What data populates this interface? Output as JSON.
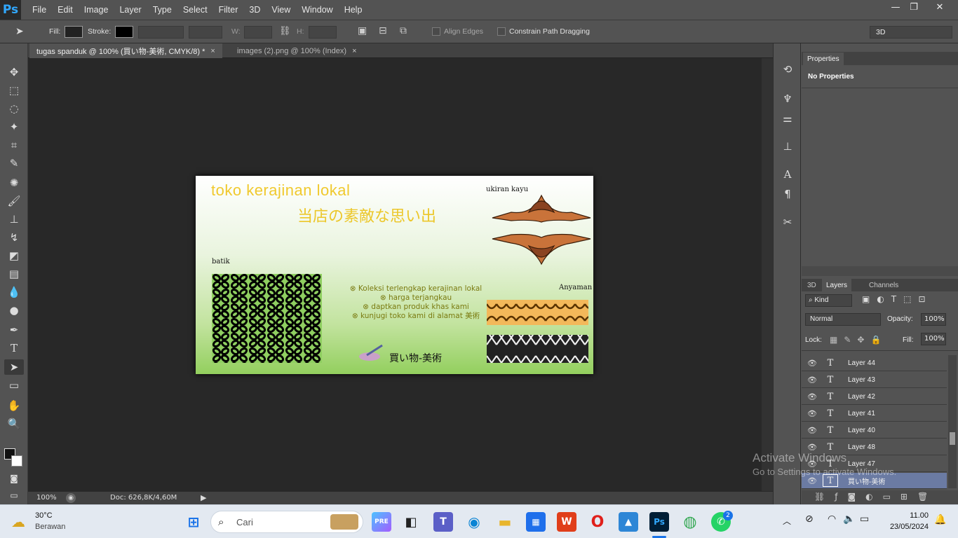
{
  "app": {
    "logo": "Ps"
  },
  "menu": [
    "File",
    "Edit",
    "Image",
    "Layer",
    "Type",
    "Select",
    "Filter",
    "3D",
    "View",
    "Window",
    "Help"
  ],
  "window_controls": {
    "minimize": "—",
    "restore": "❐",
    "close": "✕"
  },
  "options": {
    "fill_label": "Fill:",
    "stroke_label": "Stroke:",
    "w_label": "W:",
    "h_label": "H:",
    "align_edges": "Align Edges",
    "constrain_path": "Constrain Path Dragging",
    "workspace": "3D",
    "fill_color": "#222222",
    "stroke_color": "#000000"
  },
  "tabs": [
    {
      "label": "tugas spanduk @ 100% (買い物-美術, CMYK/8) *",
      "close": "×"
    },
    {
      "label": "images (2).png @ 100% (Index)",
      "close": "×"
    }
  ],
  "status": {
    "zoom": "100%",
    "doc": "Doc: 626,8K/4,60M"
  },
  "artwork": {
    "title": "toko kerajinan lokal",
    "jp_title": "当店の素敵な思い出",
    "ukiran_label": "ukiran kayu",
    "batik_label": "batik",
    "anyaman_label": "Anyaman",
    "bullets": [
      "⊗ Koleksi terlengkap kerajinan lokal",
      "⊗ harga terjangkau",
      "⊗ daptkan produk khas kami",
      "⊗ kunjugi toko kami di alamat 美術"
    ],
    "shop_name": "買い物-美術"
  },
  "properties": {
    "tab": "Properties",
    "content": "No Properties"
  },
  "layers_panel": {
    "tabs": [
      "3D",
      "Layers",
      "Channels"
    ],
    "kind": "Kind",
    "blend": "Normal",
    "opacity_label": "Opacity:",
    "opacity": "100%",
    "lock_label": "Lock:",
    "fill_label": "Fill:",
    "fill": "100%",
    "layers": [
      {
        "name": "Layer 44"
      },
      {
        "name": "Layer 43"
      },
      {
        "name": "Layer 42"
      },
      {
        "name": "Layer 41"
      },
      {
        "name": "Layer 40"
      },
      {
        "name": "Layer 48"
      },
      {
        "name": "Layer 47"
      },
      {
        "name": "買い物-美術"
      }
    ]
  },
  "watermark": {
    "line1": "Activate Windows",
    "line2": "Go to Settings to activate Windows."
  },
  "taskbar": {
    "weather_temp": "30°C",
    "weather_desc": "Berawan",
    "search_placeholder": "Cari",
    "time": "11.00",
    "date": "23/05/2024",
    "whatsapp_badge": "2"
  }
}
